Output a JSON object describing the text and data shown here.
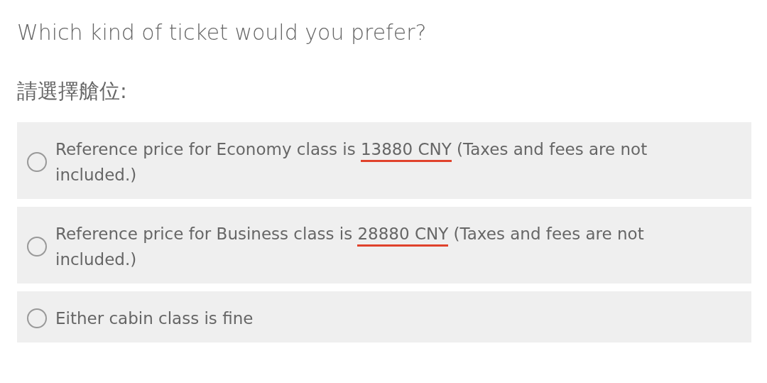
{
  "question": "Which kind of ticket would you prefer?",
  "prompt": "請選擇艙位:",
  "options": [
    {
      "before": "Reference price for Economy class is ",
      "price": "13880 CNY",
      "after": " (Taxes and fees are not included.)",
      "price_underlined": true,
      "selected": false
    },
    {
      "before": "Reference price for Business class is ",
      "price": "28880 CNY",
      "after": " (Taxes and fees are not included.)",
      "price_underlined": true,
      "selected": false
    },
    {
      "before": "Either cabin class is fine",
      "selected": false
    }
  ]
}
